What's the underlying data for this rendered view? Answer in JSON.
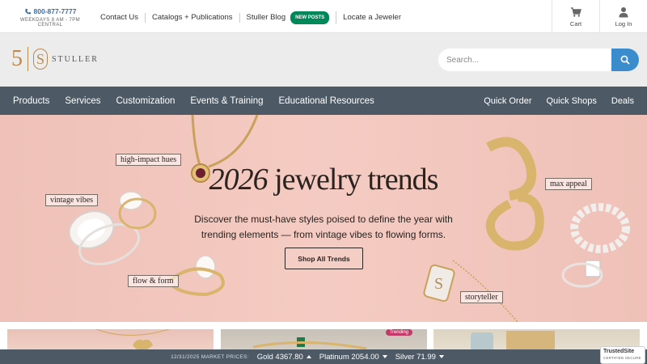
{
  "topbar": {
    "phone": "800-877-7777",
    "hours": "WEEKDAYS 8 AM - 7PM CENTRAL",
    "links": [
      "Contact Us",
      "Catalogs + Publications",
      "Stuller Blog",
      "Locate a Jeweler"
    ],
    "blog_badge": "NEW POSTS",
    "cart_label": "Cart",
    "login_label": "Log In"
  },
  "header": {
    "logo_mark": "5",
    "logo_word": "STULLER",
    "search_placeholder": "Search..."
  },
  "nav": {
    "left": [
      "Products",
      "Services",
      "Customization",
      "Events & Training",
      "Educational Resources"
    ],
    "right": [
      "Quick Order",
      "Quick Shops",
      "Deals"
    ]
  },
  "hero": {
    "title_year": "2026",
    "title_rest": "jewelry trends",
    "text": "Discover the must-have styles poised to define the year with trending elements — from vintage vibes to flowing forms.",
    "button": "Shop All Trends",
    "tags": [
      "high-impact hues",
      "vintage vibes",
      "flow & form",
      "max appeal",
      "storyteller"
    ]
  },
  "cards": {
    "trending_badge": "Trending"
  },
  "ticker": {
    "date": "12/31/2025 MARKET PRICES:",
    "gold": "Gold 4367.80",
    "platinum": "Platinum 2054.00",
    "silver": "Silver 71.99",
    "gold_dir": "up",
    "platinum_dir": "down",
    "silver_dir": "down"
  },
  "trusted": {
    "name": "TrustedSite",
    "sub": "CERTIFIED SECURE"
  },
  "colors": {
    "nav_bg": "#4d5a66",
    "search_btn": "#3b8ccd",
    "hero_bg": "#f4cbc2",
    "badge_green": "#00875a",
    "logo_gold": "#b98b52"
  }
}
